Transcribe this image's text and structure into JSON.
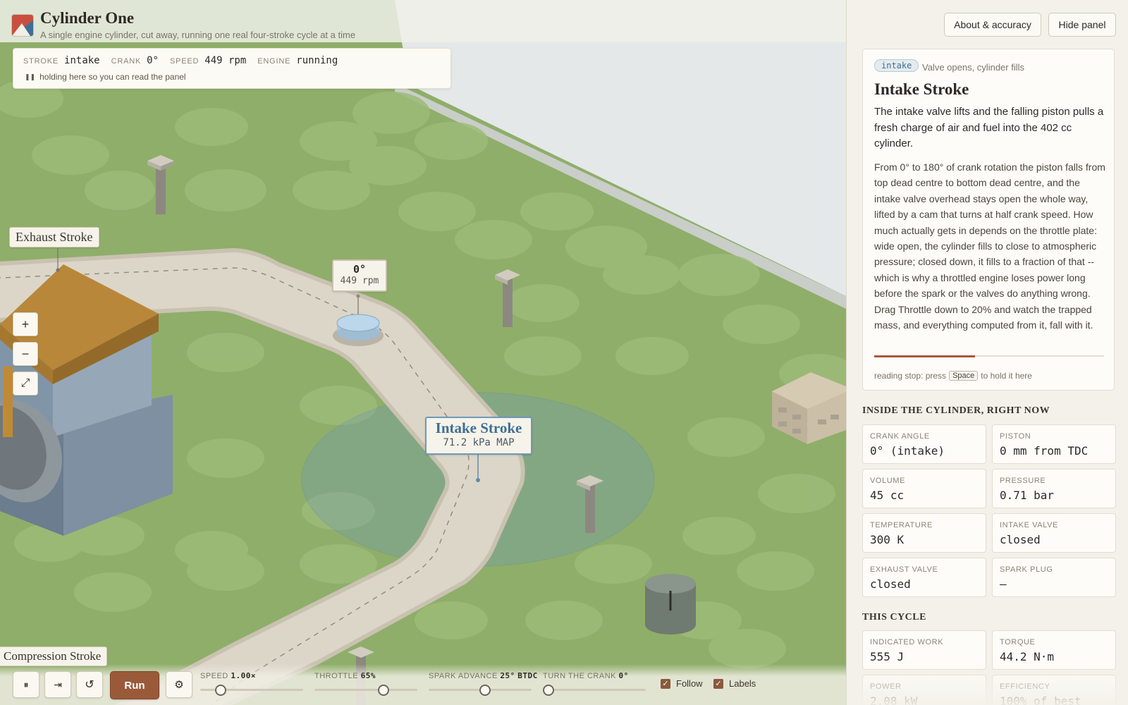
{
  "app": {
    "title": "Cylinder One",
    "subtitle": "A single engine cylinder, cut away, running one real four-stroke cycle at a time"
  },
  "status": {
    "stroke_key": "STROKE",
    "stroke_val": "intake",
    "crank_key": "CRANK",
    "crank_val": "0°",
    "speed_key": "SPEED",
    "speed_val": "449 rpm",
    "engine_key": "ENGINE",
    "engine_val": "running",
    "note": "holding here so you can read the panel",
    "note_icon": "pause-icon"
  },
  "scene": {
    "labels": {
      "exhaust": "Exhaust Stroke",
      "compression": "Compression Stroke",
      "intake_title": "Intake Stroke",
      "intake_sub": "71.2 kPa MAP"
    },
    "crank_badge": {
      "angle": "0°",
      "rpm": "449 rpm"
    },
    "colors": {
      "grass": "#8fae6a",
      "road": "#dcd6c8",
      "roof": "#b8873a",
      "intake_zone": "#6e9ab8"
    }
  },
  "zoom": {
    "in": "+",
    "out": "−",
    "fit": "⤢"
  },
  "controls": {
    "pause_icon": "⏸",
    "step_icon": "⇥",
    "reset_icon": "↺",
    "run_label": "Run",
    "settings_icon": "⚙",
    "speed": {
      "label": "SPEED",
      "value": "1.00×",
      "level": 0.15
    },
    "throttle": {
      "label": "THROTTLE",
      "value": "65%",
      "level": 0.65
    },
    "spark": {
      "label": "SPARK ADVANCE",
      "value": "25°",
      "unit": "BTDC",
      "level": 0.52
    },
    "crank": {
      "label": "TURN THE CRANK",
      "value": "0°",
      "level": 0.0
    },
    "follow": "Follow",
    "labels": "Labels"
  },
  "panel": {
    "about_button": "About & accuracy",
    "hide_button": "Hide panel",
    "tag": "intake",
    "tag_note": "Valve opens, cylinder fills",
    "heading": "Intake Stroke",
    "lede": "The intake valve lifts and the falling piston pulls a fresh charge of air and fuel into the 402 cc cylinder.",
    "body": "From 0° to 180° of crank rotation the piston falls from top dead centre to bottom dead centre, and the intake valve overhead stays open the whole way, lifted by a cam that turns at half crank speed. How much actually gets in depends on the throttle plate: wide open, the cylinder fills to close to atmospheric pressure; closed down, it fills to a fraction of that -- which is why a throttled engine loses power long before the spark or the valves do anything wrong. Drag Throttle down to 20% and watch the trapped mass, and everything computed from it, fall with it.",
    "reading_progress": 0.44,
    "reading_pre": "reading stop: press",
    "reading_key": "Space",
    "reading_post": "to hold it here",
    "section_now": "INSIDE THE CYLINDER, RIGHT NOW",
    "stats_now": [
      {
        "k": "CRANK ANGLE",
        "v": "0° (intake)"
      },
      {
        "k": "PISTON",
        "v": "0 mm from TDC"
      },
      {
        "k": "VOLUME",
        "v": "45 cc"
      },
      {
        "k": "PRESSURE",
        "v": "0.71 bar"
      },
      {
        "k": "TEMPERATURE",
        "v": "300 K"
      },
      {
        "k": "INTAKE VALVE",
        "v": "closed"
      },
      {
        "k": "EXHAUST VALVE",
        "v": "closed"
      },
      {
        "k": "SPARK PLUG",
        "v": "—"
      }
    ],
    "section_cycle": "THIS CYCLE",
    "stats_cycle": [
      {
        "k": "INDICATED WORK",
        "v": "555 J"
      },
      {
        "k": "TORQUE",
        "v": "44.2 N·m"
      },
      {
        "k": "POWER",
        "v": "2.08 kW"
      },
      {
        "k": "EFFICIENCY",
        "v": "100% of best"
      }
    ]
  }
}
